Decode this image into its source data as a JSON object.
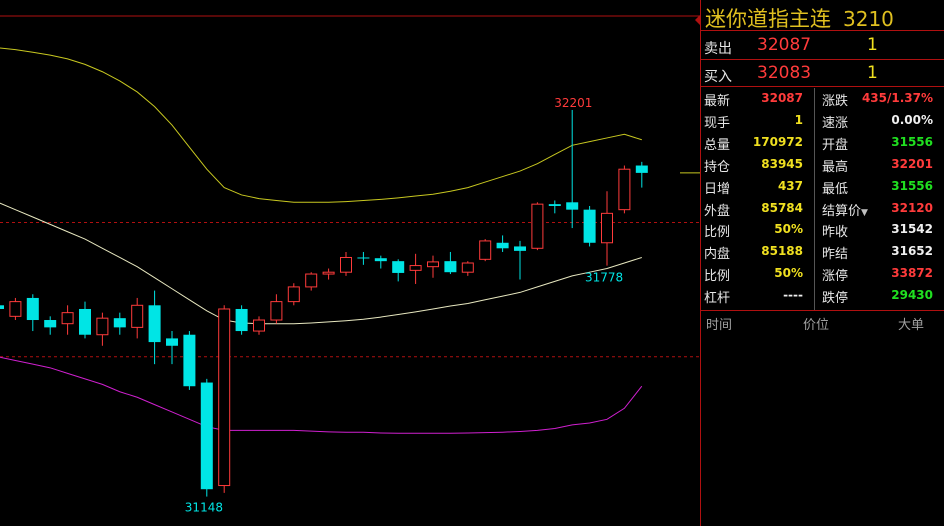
{
  "instrument": {
    "name": "迷你道指主连",
    "code": "3210"
  },
  "quote": {
    "ask_label": "卖出",
    "ask_price": "32087",
    "ask_volume": "1",
    "bid_label": "买入",
    "bid_price": "32083",
    "bid_volume": "1"
  },
  "stats": [
    {
      "l1": "最新",
      "v1": "32087",
      "c1": "red",
      "l2": "涨跌",
      "v2": "435/1.37%",
      "c2": "red"
    },
    {
      "l1": "现手",
      "v1": "1",
      "c1": "yellow",
      "l2": "速涨",
      "v2": "0.00%",
      "c2": "white"
    },
    {
      "l1": "总量",
      "v1": "170972",
      "c1": "yellow",
      "l2": "开盘",
      "v2": "31556",
      "c2": "green"
    },
    {
      "l1": "持仓",
      "v1": "83945",
      "c1": "yellow",
      "l2": "最高",
      "v2": "32201",
      "c2": "red"
    },
    {
      "l1": "日增",
      "v1": "437",
      "c1": "yellow",
      "l2": "最低",
      "v2": "31556",
      "c2": "green"
    },
    {
      "l1": "外盘",
      "v1": "85784",
      "c1": "yellow",
      "l2": "结算价",
      "v2": "32120",
      "c2": "red"
    },
    {
      "l1": "比例",
      "v1": "50%",
      "c1": "yellow",
      "l2": "昨收",
      "v2": "31542",
      "c2": "white"
    },
    {
      "l1": "内盘",
      "v1": "85188",
      "c1": "yellow",
      "l2": "昨结",
      "v2": "31652",
      "c2": "white"
    },
    {
      "l1": "比例",
      "v1": "50%",
      "c1": "yellow",
      "l2": "涨停",
      "v2": "33872",
      "c2": "red"
    },
    {
      "l1": "杠杆",
      "v1": "----",
      "c1": "white",
      "l2": "跌停",
      "v2": "29430",
      "c2": "green"
    }
  ],
  "tick_headers": {
    "time": "时间",
    "price": "价位",
    "big_order": "大单"
  },
  "colors": {
    "up": "#ff3b3b",
    "down": "#00e5e5",
    "upper_band": "#c8c820",
    "mid_band": "#e8e8c0",
    "lower_band": "#d020d0",
    "frame": "#b01010"
  },
  "chart_data": {
    "type": "candlestick",
    "annotations": {
      "high_label": "32201",
      "low_label": "31778",
      "left_low_label": "31148"
    },
    "candles": [
      {
        "o": 31670,
        "h": 31710,
        "l": 31610,
        "c": 31660
      },
      {
        "o": 31640,
        "h": 31690,
        "l": 31630,
        "c": 31680
      },
      {
        "o": 31690,
        "h": 31700,
        "l": 31600,
        "c": 31630
      },
      {
        "o": 31630,
        "h": 31640,
        "l": 31590,
        "c": 31610
      },
      {
        "o": 31620,
        "h": 31670,
        "l": 31590,
        "c": 31650
      },
      {
        "o": 31660,
        "h": 31680,
        "l": 31580,
        "c": 31590
      },
      {
        "o": 31590,
        "h": 31650,
        "l": 31560,
        "c": 31635
      },
      {
        "o": 31635,
        "h": 31650,
        "l": 31590,
        "c": 31610
      },
      {
        "o": 31610,
        "h": 31690,
        "l": 31580,
        "c": 31670
      },
      {
        "o": 31670,
        "h": 31710,
        "l": 31510,
        "c": 31570
      },
      {
        "o": 31580,
        "h": 31600,
        "l": 31510,
        "c": 31560
      },
      {
        "o": 31590,
        "h": 31600,
        "l": 31440,
        "c": 31450
      },
      {
        "o": 31460,
        "h": 31470,
        "l": 31150,
        "c": 31170
      },
      {
        "o": 31180,
        "h": 31670,
        "l": 31160,
        "c": 31660
      },
      {
        "o": 31660,
        "h": 31670,
        "l": 31590,
        "c": 31600
      },
      {
        "o": 31600,
        "h": 31640,
        "l": 31590,
        "c": 31630
      },
      {
        "o": 31630,
        "h": 31700,
        "l": 31620,
        "c": 31680
      },
      {
        "o": 31680,
        "h": 31730,
        "l": 31670,
        "c": 31720
      },
      {
        "o": 31720,
        "h": 31760,
        "l": 31710,
        "c": 31755
      },
      {
        "o": 31755,
        "h": 31770,
        "l": 31740,
        "c": 31760
      },
      {
        "o": 31760,
        "h": 31815,
        "l": 31750,
        "c": 31800
      },
      {
        "o": 31800,
        "h": 31815,
        "l": 31780,
        "c": 31798
      },
      {
        "o": 31798,
        "h": 31805,
        "l": 31770,
        "c": 31790
      },
      {
        "o": 31790,
        "h": 31795,
        "l": 31735,
        "c": 31758
      },
      {
        "o": 31765,
        "h": 31810,
        "l": 31728,
        "c": 31778
      },
      {
        "o": 31775,
        "h": 31805,
        "l": 31745,
        "c": 31788
      },
      {
        "o": 31790,
        "h": 31815,
        "l": 31755,
        "c": 31760
      },
      {
        "o": 31760,
        "h": 31790,
        "l": 31750,
        "c": 31785
      },
      {
        "o": 31795,
        "h": 31850,
        "l": 31790,
        "c": 31845
      },
      {
        "o": 31840,
        "h": 31860,
        "l": 31815,
        "c": 31825
      },
      {
        "o": 31830,
        "h": 31845,
        "l": 31740,
        "c": 31818
      },
      {
        "o": 31825,
        "h": 31950,
        "l": 31820,
        "c": 31945
      },
      {
        "o": 31945,
        "h": 31955,
        "l": 31920,
        "c": 31940
      },
      {
        "o": 31950,
        "h": 32201,
        "l": 31880,
        "c": 31930
      },
      {
        "o": 31930,
        "h": 31940,
        "l": 31830,
        "c": 31840
      },
      {
        "o": 31840,
        "h": 31980,
        "l": 31778,
        "c": 31920
      },
      {
        "o": 31930,
        "h": 32050,
        "l": 31920,
        "c": 32040
      },
      {
        "o": 32050,
        "h": 32060,
        "l": 31990,
        "c": 32030
      }
    ],
    "upper_band": [
      32370,
      32365,
      32358,
      32350,
      32340,
      32325,
      32305,
      32280,
      32250,
      32210,
      32160,
      32100,
      32040,
      31990,
      31970,
      31960,
      31955,
      31950,
      31950,
      31950,
      31952,
      31955,
      31958,
      31962,
      31967,
      31972,
      31980,
      31990,
      32005,
      32020,
      32035,
      32055,
      32080,
      32105,
      32115,
      32125,
      32135,
      32120
    ],
    "mid_band": [
      31950,
      31930,
      31910,
      31890,
      31870,
      31850,
      31825,
      31800,
      31775,
      31745,
      31715,
      31685,
      31655,
      31630,
      31622,
      31620,
      31620,
      31620,
      31622,
      31625,
      31628,
      31632,
      31638,
      31645,
      31652,
      31660,
      31668,
      31675,
      31685,
      31695,
      31705,
      31720,
      31735,
      31750,
      31760,
      31770,
      31785,
      31800
    ],
    "lower_band": [
      31530,
      31520,
      31510,
      31500,
      31485,
      31470,
      31455,
      31435,
      31420,
      31400,
      31380,
      31360,
      31340,
      31330,
      31330,
      31330,
      31330,
      31330,
      31328,
      31326,
      31325,
      31325,
      31323,
      31322,
      31322,
      31322,
      31322,
      31323,
      31324,
      31325,
      31327,
      31330,
      31335,
      31345,
      31350,
      31360,
      31390,
      31450
    ],
    "dashed_levels": [
      31895,
      31530
    ]
  }
}
